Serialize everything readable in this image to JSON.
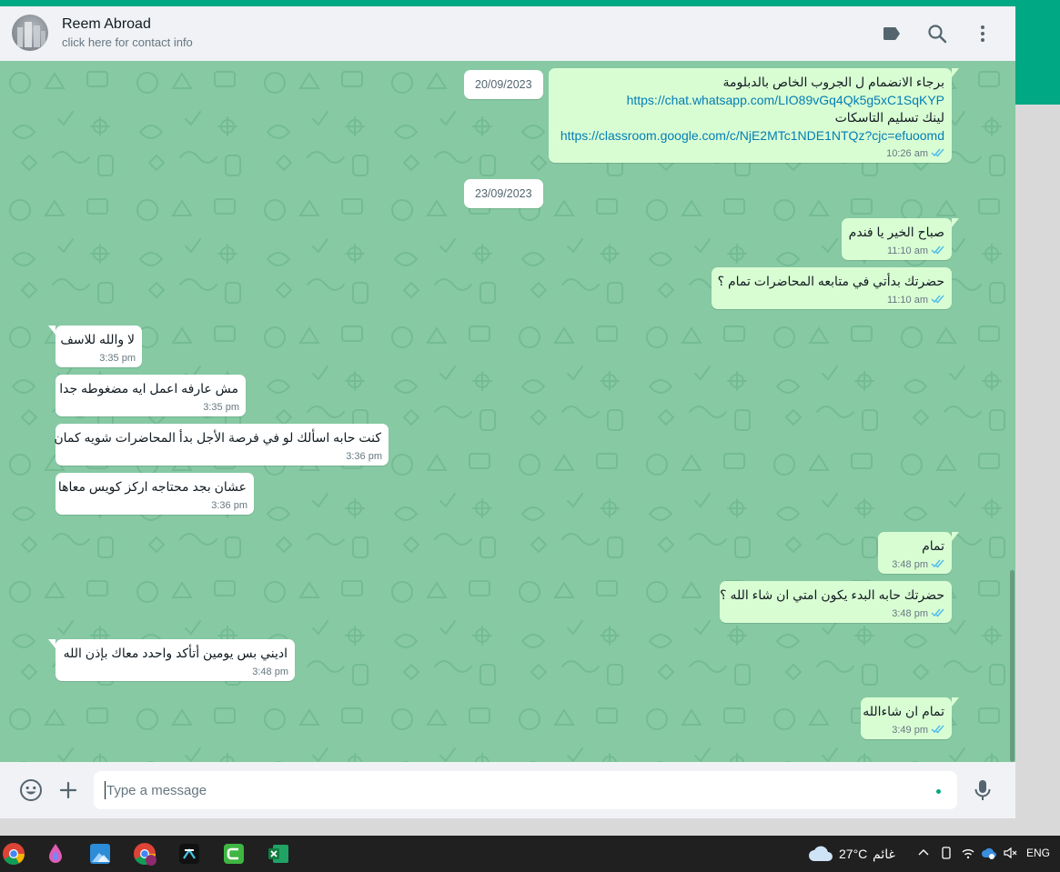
{
  "header": {
    "contact_name": "Reem Abroad",
    "contact_subtitle": "click here for contact info",
    "icons": [
      "label-icon",
      "search-icon",
      "more-options-icon"
    ]
  },
  "chat": {
    "date_separators": [
      "20/09/2023",
      "23/09/2023"
    ],
    "messages": [
      {
        "direction": "outgoing",
        "lines": [
          "برجاء الانضمام ل الجروب الخاص بالدبلومة",
          "https://chat.whatsapp.com/LIO89vGq4Qk5g5xC1SqKYP",
          "لينك تسليم التاسكات",
          "https://classroom.google.com/c/NjE2MTc1NDE1NTQz?cjc=efuoomd"
        ],
        "time": "10:26 am",
        "status": "read"
      },
      {
        "direction": "outgoing",
        "lines": [
          "صباح الخير يا فندم"
        ],
        "time": "11:10 am",
        "status": "read"
      },
      {
        "direction": "outgoing",
        "lines": [
          "حضرتك بدأتي في متابعه المحاضرات تمام ؟"
        ],
        "time": "11:10 am",
        "status": "read"
      },
      {
        "direction": "incoming",
        "lines": [
          "لا والله للاسف"
        ],
        "time": "3:35 pm"
      },
      {
        "direction": "incoming",
        "lines": [
          "مش عارفه اعمل ايه مضغوطه جدا"
        ],
        "time": "3:35 pm"
      },
      {
        "direction": "incoming",
        "lines": [
          "كنت حابه اسألك لو في فرصة الأجل بدأ المحاضرات شويه كمان"
        ],
        "time": "3:36 pm"
      },
      {
        "direction": "incoming",
        "lines": [
          "عشان بجد محتاجه اركز كويس معاها"
        ],
        "time": "3:36 pm"
      },
      {
        "direction": "outgoing",
        "lines": [
          "تمام"
        ],
        "time": "3:48 pm",
        "status": "read"
      },
      {
        "direction": "outgoing",
        "lines": [
          "حضرتك حابه البدء يكون امتي ان شاء الله ؟"
        ],
        "time": "3:48 pm",
        "status": "read"
      },
      {
        "direction": "incoming",
        "lines": [
          "اديني بس يومين أتأكد واحدد معاك بإذن الله"
        ],
        "time": "3:48 pm"
      },
      {
        "direction": "outgoing",
        "lines": [
          "تمام ان شاءالله"
        ],
        "time": "3:49 pm",
        "status": "read"
      }
    ]
  },
  "composer": {
    "placeholder": "Type a message",
    "value": "",
    "icons": [
      "emoji-icon",
      "attach-icon",
      "microphone-icon"
    ]
  },
  "taskbar": {
    "apps": [
      "chrome-icon",
      "paint-drop-icon",
      "photos-icon",
      "chrome-profile-icon",
      "capcut-icon",
      "camtasia-icon",
      "excel-icon"
    ],
    "weather_temp": "27°C",
    "weather_condition": "غائم",
    "language": "ENG"
  },
  "colors": {
    "accent": "#00a884",
    "chat_background": "#86c9a3",
    "outgoing_bubble": "#d9fdd3",
    "incoming_bubble": "#ffffff",
    "read_ticks": "#53bdeb",
    "link": "#027eb5"
  }
}
